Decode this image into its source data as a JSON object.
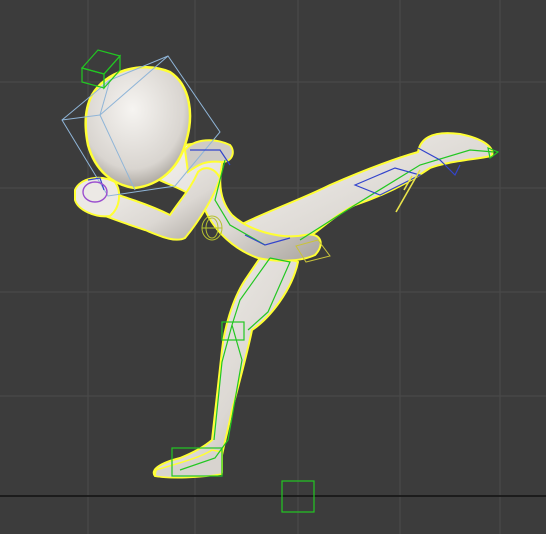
{
  "viewport": {
    "kind": "3d-perspective-viewport",
    "background_color": "#3c3c3c",
    "grid_color": "#4a4a4a",
    "ground_line_color": "#111111",
    "grid": true
  },
  "character": {
    "pose": "high-kick",
    "mesh_color": "#e8e6e3",
    "selection_outline_color": "#ffff33",
    "bone_color": "#22c722",
    "ik_handle_color": "#3344cc",
    "head_bbox_color": "#8fb5d8"
  },
  "gizmos": {
    "root_control": "green-square-icon",
    "head_control": "green-box-icon",
    "ik_handle": "ik-handle-icon"
  }
}
